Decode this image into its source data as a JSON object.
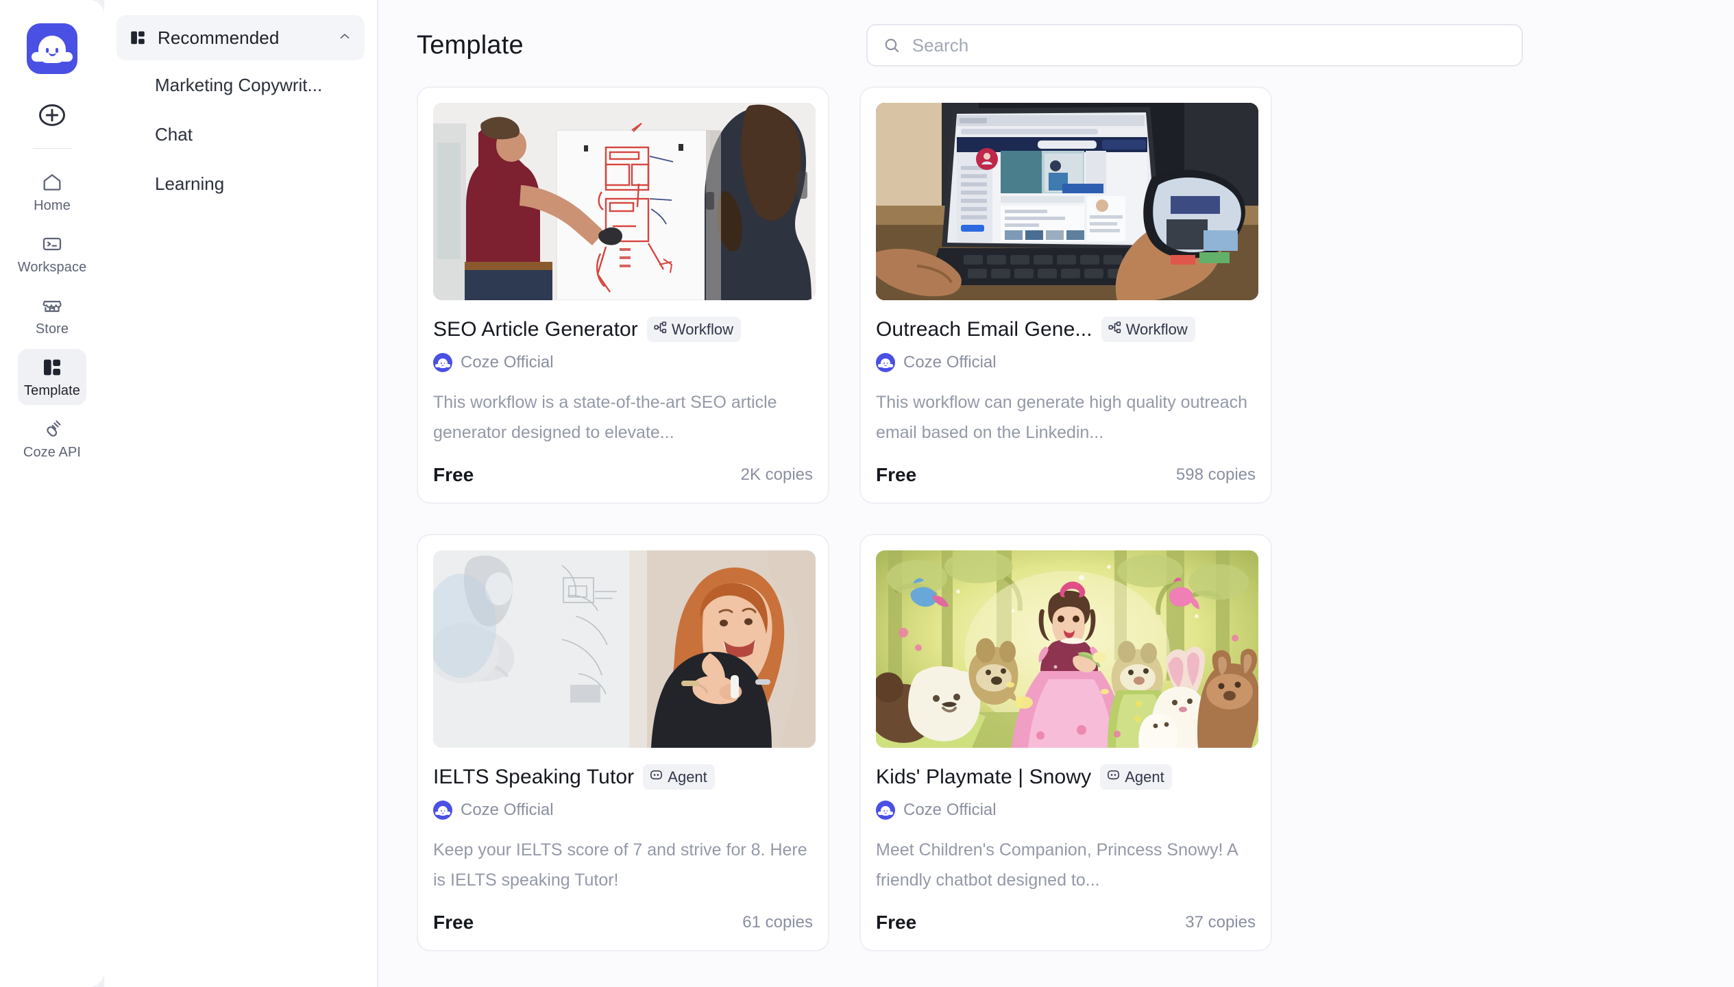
{
  "app": {
    "logo_icon": "coze-ghost-logo",
    "accent_color": "#4a50e4"
  },
  "rail": {
    "create_icon": "plus-circle-icon",
    "items": [
      {
        "label": "Home",
        "icon": "home-icon",
        "active": false
      },
      {
        "label": "Workspace",
        "icon": "terminal-folder-icon",
        "active": false
      },
      {
        "label": "Store",
        "icon": "store-icon",
        "active": false
      },
      {
        "label": "Template",
        "icon": "layout-grid-icon",
        "active": true
      },
      {
        "label": "Coze API",
        "icon": "plug-connect-icon",
        "active": false
      }
    ]
  },
  "categories": {
    "header": {
      "label": "Recommended",
      "icon": "layout-grid-icon",
      "chevron": "chevron-up-icon"
    },
    "items": [
      {
        "label": "Marketing Copywrit..."
      },
      {
        "label": "Chat"
      },
      {
        "label": "Learning"
      }
    ]
  },
  "header": {
    "title": "Template"
  },
  "search": {
    "icon": "search-icon",
    "placeholder": "Search",
    "value": ""
  },
  "cards": [
    {
      "title": "SEO Article Generator",
      "badge": {
        "label": "Workflow",
        "icon": "workflow-nodes-icon"
      },
      "author": {
        "name": "Coze Official",
        "avatar": "coze-official-avatar"
      },
      "description": "This workflow is a state-of-the-art SEO article generator designed to elevate...",
      "price": "Free",
      "copies": "2K copies",
      "thumbnail": "two-people-whiteboard-photo"
    },
    {
      "title": "Outreach Email Gene...",
      "badge": {
        "label": "Workflow",
        "icon": "workflow-nodes-icon"
      },
      "author": {
        "name": "Coze Official",
        "avatar": "coze-official-avatar"
      },
      "description": "This workflow can generate high quality outreach email based on the Linkedin...",
      "price": "Free",
      "copies": "598 copies",
      "thumbnail": "laptop-social-profile-photo"
    },
    {
      "title": "IELTS Speaking Tutor",
      "badge": {
        "label": "Agent",
        "icon": "agent-face-icon"
      },
      "author": {
        "name": "Coze Official",
        "avatar": "coze-official-avatar"
      },
      "description": "Keep your IELTS score of 7 and strive for 8. Here is IELTS speaking Tutor!",
      "price": "Free",
      "copies": "61 copies",
      "thumbnail": "smiling-woman-whiteboard-photo"
    },
    {
      "title": "Kids' Playmate | Snowy",
      "badge": {
        "label": "Agent",
        "icon": "agent-face-icon"
      },
      "author": {
        "name": "Coze Official",
        "avatar": "coze-official-avatar"
      },
      "description": "Meet Children's Companion, Princess Snowy! A friendly chatbot designed to...",
      "price": "Free",
      "copies": "37 copies",
      "thumbnail": "princess-forest-animals-illustration"
    }
  ]
}
